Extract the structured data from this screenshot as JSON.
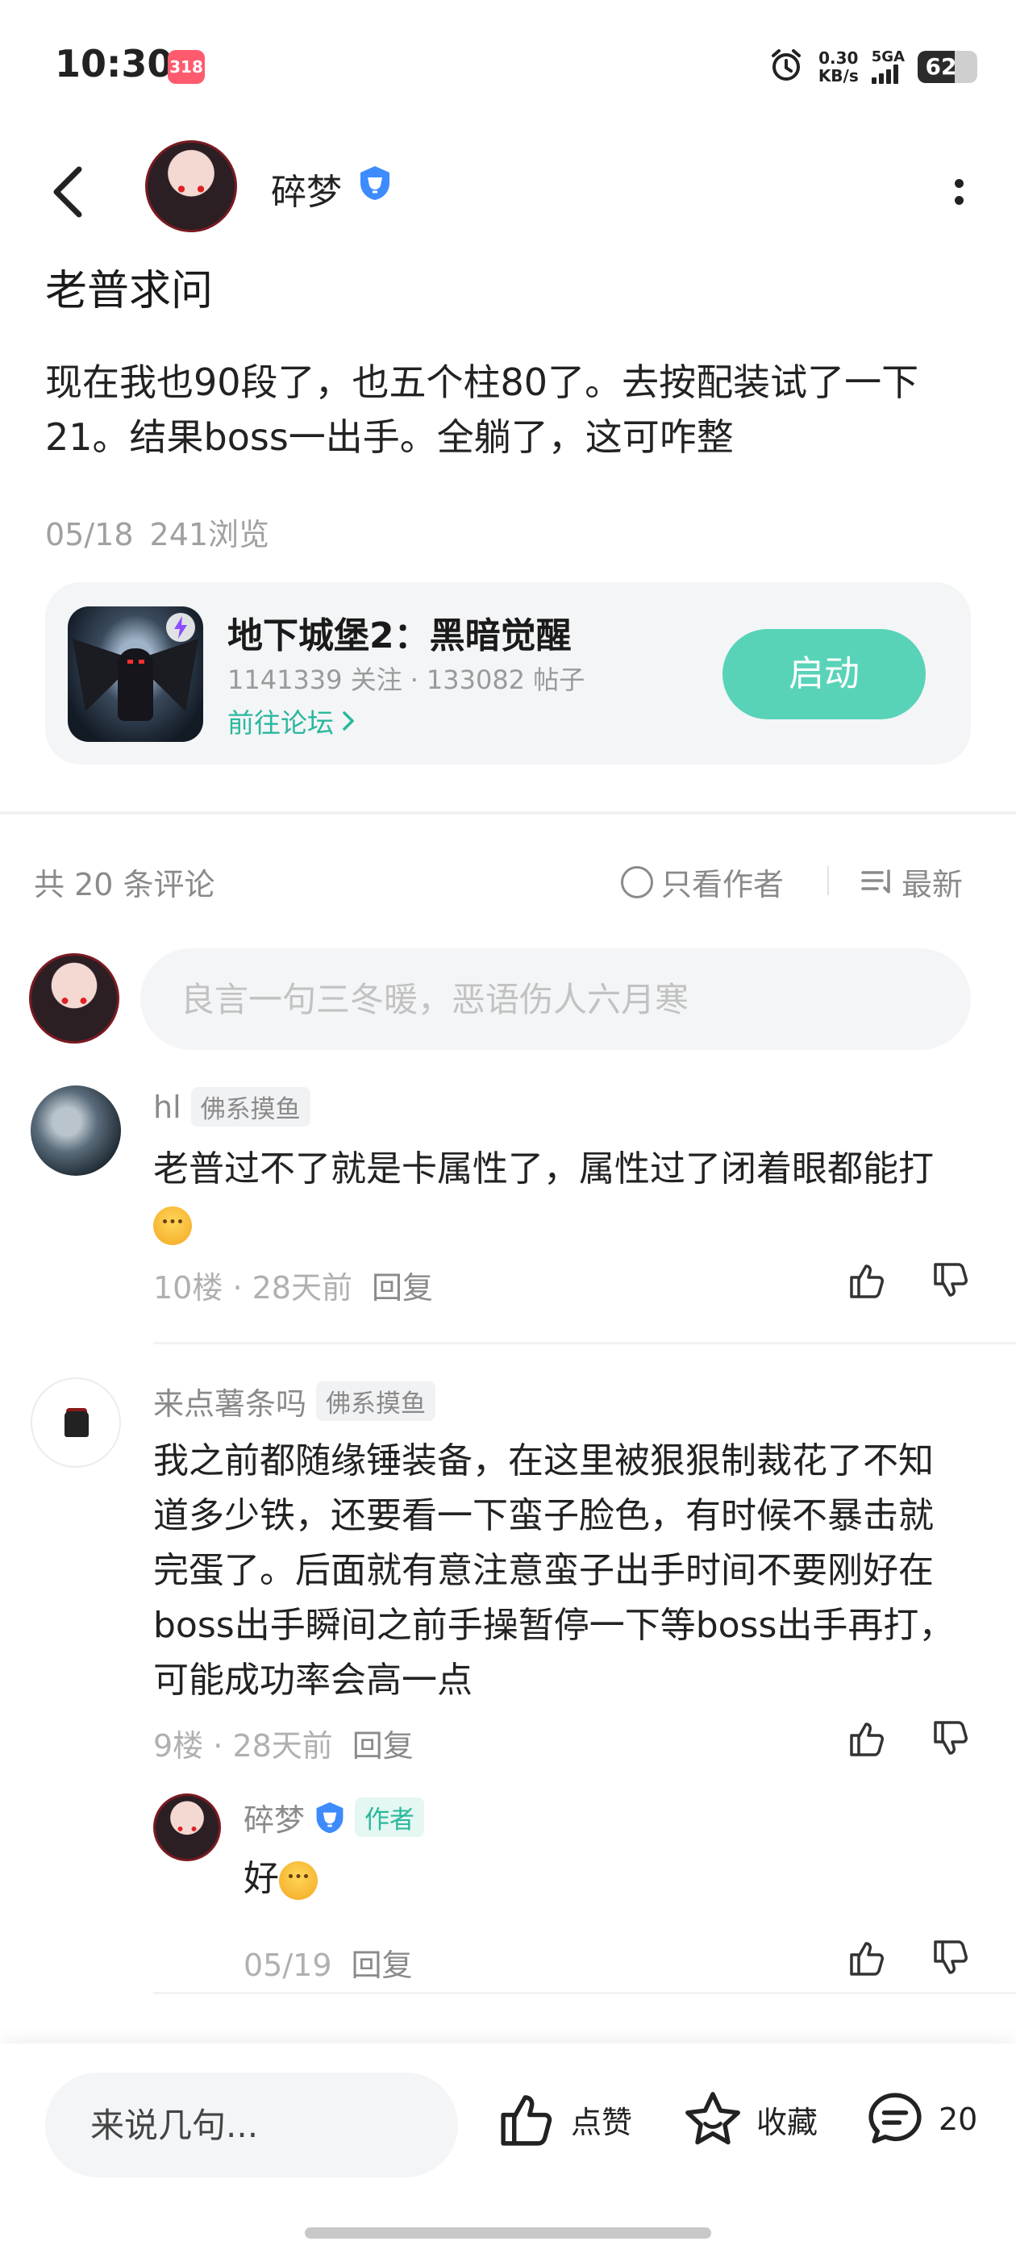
{
  "status_bar": {
    "time": "10:30",
    "app_badge": "318",
    "net_speed_value": "0.30",
    "net_speed_unit": "KB/s",
    "network": "5GA",
    "battery": "62",
    "battery_level": 0.62
  },
  "header": {
    "username": "碎梦"
  },
  "post": {
    "title": "老普求问",
    "body": "现在我也90段了，也五个柱80了。去按配装试了一下21。结果boss一出手。全躺了，这可咋整",
    "date": "05/18",
    "views": "241浏览"
  },
  "game_card": {
    "name": "地下城堡2：黑暗觉醒",
    "followers": "1141339 关注",
    "posts": "133082 帖子",
    "forum_link": "前往论坛",
    "launch_label": "启动",
    "accent_color": "#58d3b8"
  },
  "comments_header": {
    "count_label": "共 20 条评论",
    "author_only_label": "只看作者",
    "sort_label": "最新"
  },
  "comment_input": {
    "placeholder": "良言一句三冬暖，恶语伤人六月寒"
  },
  "comments": [
    {
      "user": "hl",
      "tag": "佛系摸鱼",
      "text": "老普过不了就是卡属性了，属性过了闭着眼都能打",
      "floor": "10楼",
      "time": "28天前",
      "reply_label": "回复"
    },
    {
      "user": "来点薯条吗",
      "tag": "佛系摸鱼",
      "text": "我之前都随缘锤装备，在这里被狠狠制裁花了不知道多少铁，还要看一下蛮子脸色，有时候不暴击就完蛋了。后面就有意注意蛮子出手时间不要刚好在boss出手瞬间之前手操暂停一下等boss出手再打，可能成功率会高一点",
      "floor": "9楼",
      "time": "28天前",
      "reply_label": "回复",
      "replies": [
        {
          "user": "碎梦",
          "tag": "作者",
          "text": "好",
          "date": "05/19",
          "reply_label": "回复"
        }
      ]
    }
  ],
  "bottom_bar": {
    "input_placeholder": "来说几句...",
    "like_label": "点赞",
    "favorite_label": "收藏",
    "comment_count": "20"
  },
  "icons": {
    "back": "chevron-left-icon",
    "verified": "verified-badge-icon",
    "more": "more-vertical-icon",
    "like": "thumbs-up-icon",
    "dislike": "thumbs-down-icon",
    "favorite": "star-icon",
    "comment": "comment-bubble-icon",
    "sort": "sort-list-icon"
  }
}
